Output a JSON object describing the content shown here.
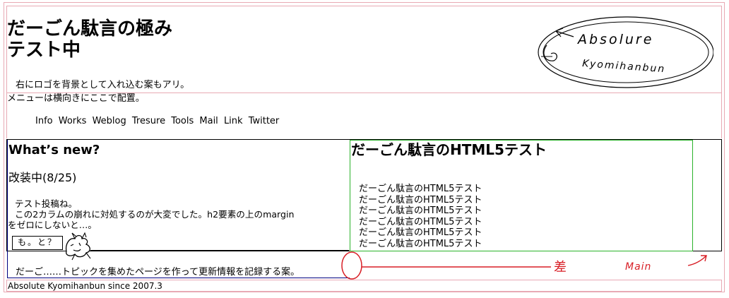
{
  "header": {
    "title_line1": "だーごん駄言の極み",
    "title_line2": "テスト中",
    "note": "右にロゴを背景として入れ込む案もアリ。",
    "logo_text_line1": "Absolure",
    "logo_text_line2": "Kyomihanbun"
  },
  "nav": {
    "note": "メニューは横向きにここで配置。",
    "links": [
      "Info",
      "Works",
      "Weblog",
      "Tresure",
      "Tools",
      "Mail",
      "Link",
      "Twitter"
    ]
  },
  "sidebar": {
    "title": "What’s new?",
    "subtitle": "改装中(8/25)",
    "text_line1": "テスト投稿ね。",
    "text_line2": "この2カラムの崩れに対処するのが大変でした。h2要素の上のmargin",
    "text_line3": "をゼロにしないと…。",
    "motto": "も。と？",
    "note": "だーご……トピックを集めたページを作って更新情報を記録する案。"
  },
  "main": {
    "title": "だーごん駄言のHTML5テスト",
    "items": [
      "だーごん駄言のHTML5テスト",
      "だーごん駄言のHTML5テスト",
      "だーごん駄言のHTML5テスト",
      "だーごん駄言のHTML5テスト",
      "だーごん駄言のHTML5テスト",
      "だーごん駄言のHTML5テスト"
    ]
  },
  "annotations": {
    "diff_label": "差",
    "main_label": "Main",
    "color": "#d81f26"
  },
  "footer": {
    "text": "Absolute Kyomihanbun since 2007.3"
  }
}
